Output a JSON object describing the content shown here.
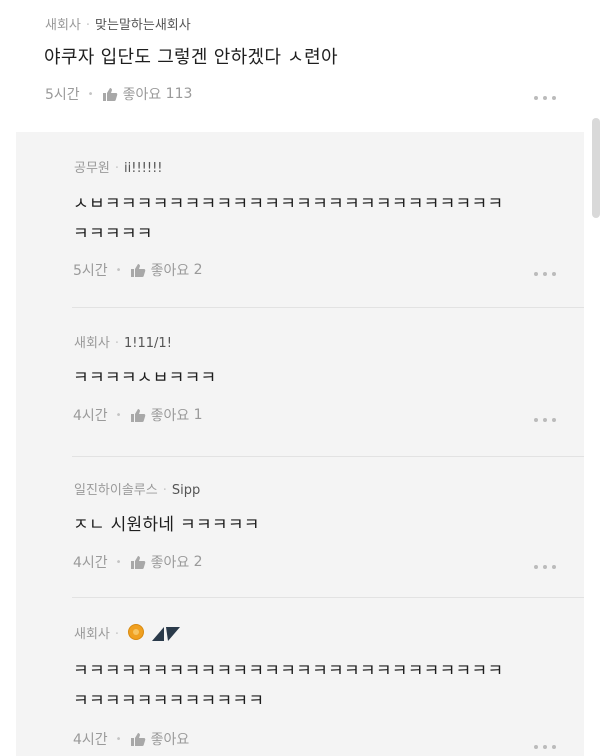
{
  "post": {
    "company": "새회사",
    "nickname": "맞는말하는새회사",
    "text": "야쿠자 입단도 그렇겐 안하겠다 ㅅ련아",
    "time": "5시간",
    "like_label": "좋아요",
    "like_count": "113"
  },
  "replies": [
    {
      "company": "공무원",
      "nickname": "ii!!!!!!",
      "lines": [
        "ㅅㅂㅋㅋㅋㅋㅋㅋㅋㅋㅋㅋㅋㅋㅋㅋㅋㅋㅋㅋㅋㅋㅋㅋㅋㅋㅋ",
        "ㅋㅋㅋㅋㅋ"
      ],
      "time": "5시간",
      "like_label": "좋아요",
      "like_count": "2"
    },
    {
      "company": "새회사",
      "nickname": "1!11/1!",
      "lines": [
        "ㅋㅋㅋㅋㅅㅂㅋㅋㅋ"
      ],
      "time": "4시간",
      "like_label": "좋아요",
      "like_count": "1"
    },
    {
      "company": "일진하이솔루스",
      "nickname": "Sipp",
      "lines": [
        "ㅈㄴ 시원하네 ㅋㅋㅋㅋㅋ"
      ],
      "time": "4시간",
      "like_label": "좋아요",
      "like_count": "2"
    },
    {
      "company": "새회사",
      "nickname": "",
      "lines": [
        "ㅋㅋㅋㅋㅋㅋㅋㅋㅋㅋㅋㅋㅋㅋㅋㅋㅋㅋㅋㅋㅋㅋㅋㅋㅋㅋㅋ",
        "ㅋㅋㅋㅋㅋㅋㅋㅋㅋㅋㅋㅋ"
      ],
      "time": "4시간",
      "like_label": "좋아요",
      "like_count": ""
    }
  ],
  "icons": {
    "thumb": "thumbs-up-icon",
    "more": "more-dots-icon",
    "coin": "coin-emoji-icon",
    "triangles": "triangle-badge-icon"
  },
  "colors": {
    "reply_bg": "#f4f4f4",
    "meta_text": "#9a9a9a",
    "icon_dark": "#2a3a4a"
  }
}
